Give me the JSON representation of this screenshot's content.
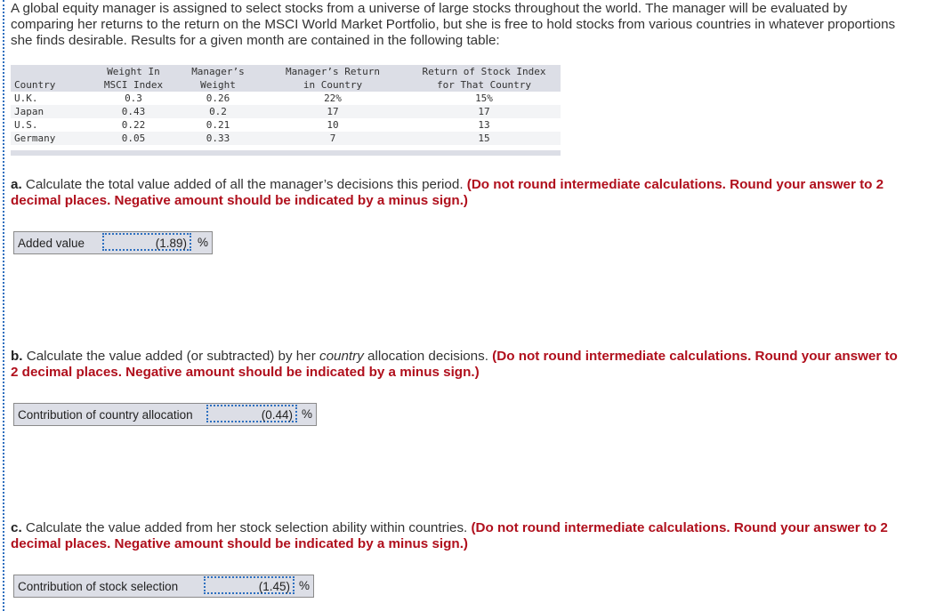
{
  "intro": "A global equity manager is assigned to select stocks from a universe of large stocks throughout the world. The manager will be evaluated by comparing her returns to the return on the MSCI World Market Portfolio, but she is free to hold stocks from various countries in whatever proportions she finds desirable. Results for a given month are contained in the following table:",
  "table": {
    "headers": [
      [
        "",
        "Country"
      ],
      [
        "Weight In",
        "MSCI Index"
      ],
      [
        "Manager’s",
        "Weight"
      ],
      [
        "Manager’s Return",
        "in Country"
      ],
      [
        "Return of Stock Index",
        "for That Country"
      ]
    ],
    "rows": [
      [
        "U.K.",
        "0.3",
        "0.26",
        "22%",
        "15%"
      ],
      [
        "Japan",
        "0.43",
        "0.2",
        "17",
        "17"
      ],
      [
        "U.S.",
        "0.22",
        "0.21",
        "10",
        "13"
      ],
      [
        "Germany",
        "0.05",
        "0.33",
        "7",
        "15"
      ]
    ]
  },
  "questions": [
    {
      "letter": "a.",
      "text": " Calculate the total value added of all the manager’s decisions this period. ",
      "instruction": "(Do not round intermediate calculations. Round your answer to 2 decimal places. Negative amount should be indicated by a minus sign.)",
      "answer_label": "Added value",
      "answer_value": "(1.89)",
      "unit": "%"
    },
    {
      "letter": "b.",
      "text_before": " Calculate the value added (or subtracted) by her ",
      "text_italic": "country",
      "text_after": " allocation decisions. ",
      "instruction": "(Do not round intermediate calculations. Round your answer to 2 decimal places. Negative amount should be indicated by a minus sign.)",
      "answer_label": "Contribution of country allocation",
      "answer_value": "(0.44)",
      "unit": "%"
    },
    {
      "letter": "c.",
      "text": " Calculate the value added from her stock selection ability within countries. ",
      "instruction": "(Do not round intermediate calculations. Round your answer to 2 decimal places. Negative amount should be indicated by a minus sign.)",
      "answer_label": "Contribution of stock selection",
      "answer_value": "(1.45)",
      "unit": "%"
    }
  ],
  "colors": {
    "instruction_red": "#b00f1c",
    "focus_blue": "#2d6fbf",
    "header_gray": "#dcdee6"
  }
}
